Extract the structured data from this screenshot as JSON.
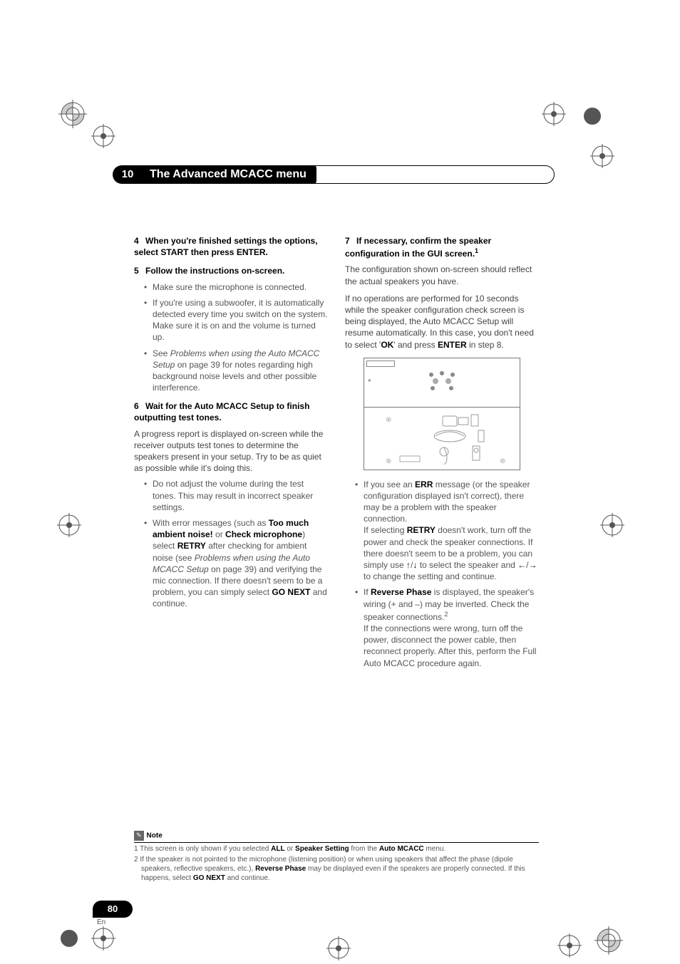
{
  "chapter": {
    "number": "10",
    "title": "The Advanced MCACC menu"
  },
  "left": {
    "s4": {
      "num": "4",
      "title": "When you're finished settings the options, select START then press ENTER."
    },
    "s5": {
      "num": "5",
      "title": "Follow the instructions on-screen.",
      "b1": "Make sure the microphone is connected.",
      "b2": "If you're using a subwoofer, it is automatically detected every time you switch on the system. Make sure it is on and the volume is turned up.",
      "b3a": "See ",
      "b3i": "Problems when using the Auto MCACC Setup",
      "b3b": " on page 39 for notes regarding high background noise levels and other possible interference."
    },
    "s6": {
      "num": "6",
      "title": "Wait for the Auto MCACC Setup to finish outputting test tones.",
      "p": "A progress report is displayed on-screen while the receiver outputs test tones to determine the speakers present in your setup. Try to be as quiet as possible while it's doing this.",
      "b1": "Do not adjust the volume during the test tones. This may result in incorrect speaker settings.",
      "b2a": "With error messages (such as ",
      "b2b1": "Too much ambient noise!",
      "b2c": " or ",
      "b2b2": "Check microphone",
      "b2d": ") select ",
      "b2b3": "RETRY",
      "b2e": " after checking for ambient noise (see ",
      "b2i": "Problems when using the Auto MCACC Setup",
      "b2f": " on page 39) and verifying the mic connection. If there doesn't seem to be a problem, you can simply select ",
      "b2b4": "GO NEXT",
      "b2g": " and continue."
    }
  },
  "right": {
    "s7": {
      "num": "7",
      "title": "If necessary, confirm the speaker configuration in the GUI screen.",
      "sup": "1",
      "p1": "The configuration shown on-screen should reflect the actual speakers you have.",
      "p2a": "If no operations are performed for 10 seconds while the speaker configuration check screen is being displayed, the Auto MCACC Setup will resume automatically. In this case, you don't need to select '",
      "p2b1": "OK",
      "p2b": "' and press ",
      "p2b2": "ENTER",
      "p2c": " in step 8."
    },
    "b1": {
      "a": "If you see an ",
      "b1": "ERR",
      "b": " message (or the speaker configuration displayed isn't correct), there may be a problem with the speaker connection.",
      "c": "If selecting ",
      "b2": "RETRY",
      "d": " doesn't work, turn off the power and check the speaker connections. If there doesn't seem to be a problem, you can simply use ",
      "ar1": "↑",
      "sl1": "/",
      "ar2": "↓",
      "e": " to select the speaker and ",
      "ar3": "←",
      "sl2": "/",
      "ar4": "→",
      "f": " to change the setting and continue."
    },
    "b2": {
      "a": "If ",
      "b1": "Reverse Phase",
      "b": " is displayed, the speaker's wiring (+ and –) may be inverted. Check the speaker connections.",
      "sup": "2",
      "c": "If the connections were wrong, turn off the power, disconnect the power cable, then reconnect properly. After this, perform the Full Auto MCACC procedure again."
    }
  },
  "note": {
    "label": "Note",
    "n1a": "1 This screen is only shown if you selected ",
    "n1b1": "ALL",
    "n1b": " or ",
    "n1b2": "Speaker Setting",
    "n1c": " from the ",
    "n1b3": "Auto MCACC",
    "n1d": " menu.",
    "n2a": "2 If the speaker is not pointed to the microphone (listening position) or when using speakers that affect the phase (dipole speakers, reflective speakers, etc.), ",
    "n2b1": "Reverse Phase",
    "n2b": " may be displayed even if the speakers are properly connected. If this happens, select ",
    "n2b2": "GO NEXT",
    "n2c": " and continue."
  },
  "page": {
    "num": "80",
    "lang": "En"
  }
}
